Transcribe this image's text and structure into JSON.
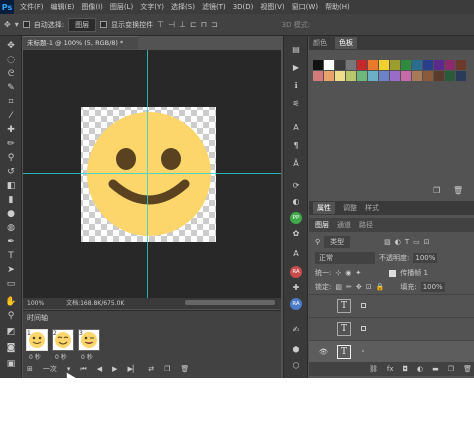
{
  "menubar": {
    "logo": "Ps",
    "items": [
      "文件(F)",
      "编辑(E)",
      "图像(I)",
      "图层(L)",
      "文字(Y)",
      "选择(S)",
      "滤镜(T)",
      "3D(D)",
      "视图(V)",
      "窗口(W)",
      "帮助(H)"
    ]
  },
  "options": {
    "auto_select_label": "自动选择:",
    "auto_select_value": "图层",
    "show_transform_label": "显示变换控件",
    "mode_3d_label": "3D 模式:"
  },
  "document": {
    "tab_title": "未标题-1 @ 100% (5, RGB/8) *",
    "zoom": "100%",
    "doc_info": "文档:168.8K/675.0K"
  },
  "timeline": {
    "title": "时间轴",
    "frames": [
      {
        "num": "1",
        "delay": "0 秒"
      },
      {
        "num": "2",
        "delay": "0 秒"
      },
      {
        "num": "3",
        "delay": "0 秒"
      }
    ],
    "loop_value": "一次"
  },
  "panels": {
    "color_tabs": [
      "颜色",
      "色板"
    ],
    "active_color_tab": "色板",
    "props_tabs": [
      "属性",
      "调整",
      "样式"
    ],
    "layers_tabs": [
      "图层",
      "通道",
      "路径"
    ],
    "kind_label": "类型",
    "blend_mode": "正常",
    "opacity_label": "不透明度:",
    "opacity_value": "100%",
    "unify_label": "统一:",
    "propagate_label": "传播帧 1",
    "lock_label": "锁定:",
    "fill_label": "填充:",
    "fill_value": "100%"
  },
  "swatch_colors": [
    "#111111",
    "#ffffff",
    "#3b3b3b",
    "#777777",
    "#c42a2a",
    "#e8792d",
    "#f2d12c",
    "#9c9c2f",
    "#2d8a3e",
    "#2a6d8c",
    "#2a3f8c",
    "#5c2a8c",
    "#8c2a6b",
    "#6b3a2a",
    "#d47a7a",
    "#e8a36b",
    "#f0dd8a",
    "#b8c76b",
    "#6bb87a",
    "#6bb0c7",
    "#6b82c7",
    "#9a6bc7",
    "#c76ba8",
    "#a87a5a",
    "#8a5a3a",
    "#5a3a2a",
    "#2a5a3a",
    "#2a3a5a"
  ],
  "layers": [
    {
      "name": "",
      "type": "T"
    },
    {
      "name": "",
      "type": "T"
    },
    {
      "name": "",
      "type": "T"
    }
  ],
  "emoji": {
    "face_color": "#fcd66a",
    "feature_color": "#5a4220"
  }
}
